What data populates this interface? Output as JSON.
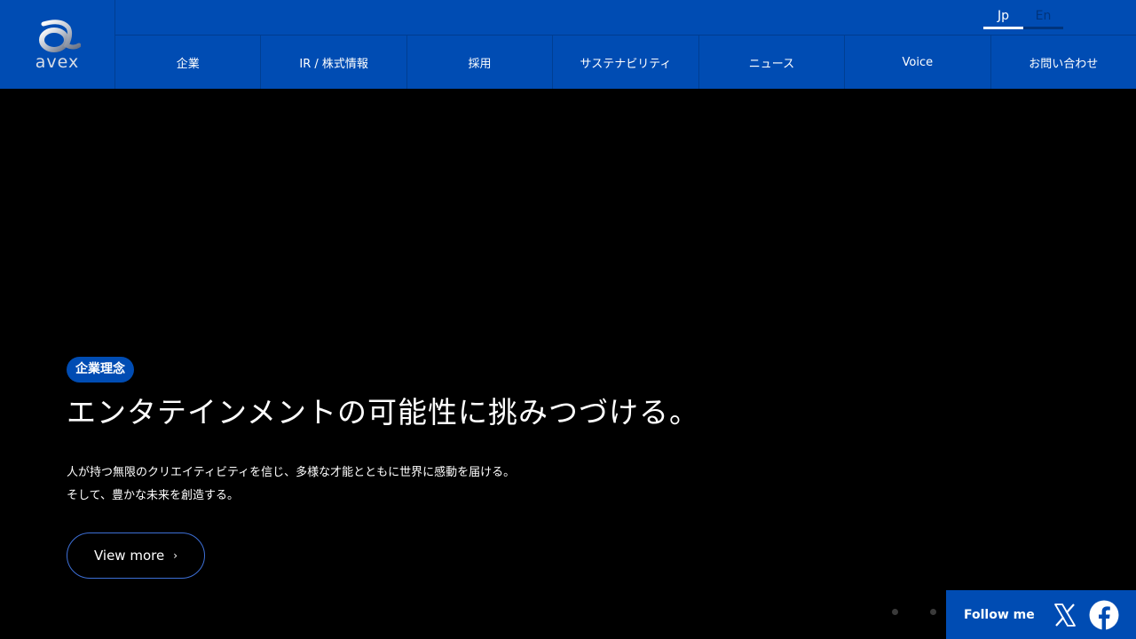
{
  "brand": {
    "logo_text": "avex"
  },
  "lang": {
    "jp": "Jp",
    "en": "En"
  },
  "nav": {
    "items": [
      {
        "label": "企業"
      },
      {
        "label": "IR / 株式情報"
      },
      {
        "label": "採用"
      },
      {
        "label": "サステナビリティ"
      },
      {
        "label": "ニュース"
      },
      {
        "label": "Voice"
      },
      {
        "label": "お問い合わせ"
      }
    ]
  },
  "hero": {
    "badge": "企業理念",
    "headline": "エンタテインメントの可能性に挑みつづける。",
    "desc_line1": "人が持つ無限のクリエイティビティを信じ、多様な才能とともに世界に感動を届ける。",
    "desc_line2": "そして、豊かな未来を創造する。",
    "cta": "View more"
  },
  "follow": {
    "label": "Follow me"
  },
  "colors": {
    "brand_blue": "#004cb3",
    "cta_border": "#3d6fd6"
  },
  "icons": [
    "avex-logo-icon",
    "chevron-right-icon",
    "x-icon",
    "facebook-icon"
  ]
}
